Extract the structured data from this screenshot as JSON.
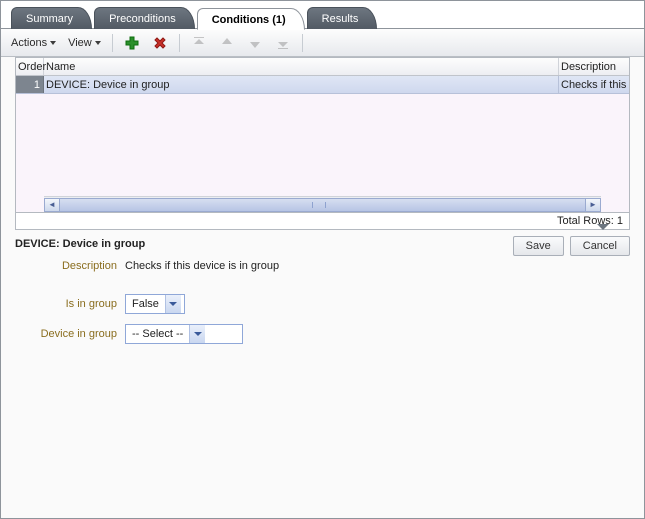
{
  "tabs": {
    "summary": "Summary",
    "preconditions": "Preconditions",
    "conditions": "Conditions (1)",
    "results": "Results"
  },
  "toolbar": {
    "actions": "Actions",
    "view": "View"
  },
  "grid": {
    "headers": {
      "order": "Order",
      "name": "Name",
      "description": "Description"
    },
    "rows": [
      {
        "order": "1",
        "name": "DEVICE: Device in group",
        "description": "Checks if this dev"
      }
    ],
    "total_label": "Total Rows: 1"
  },
  "detail": {
    "title": "DEVICE: Device in group",
    "save": "Save",
    "cancel": "Cancel",
    "description_label": "Description",
    "description_value": "Checks if this device is in group",
    "isingroup_label": "Is in group",
    "isingroup_value": "False",
    "devicegroup_label": "Device in group",
    "devicegroup_value": "-- Select --"
  }
}
